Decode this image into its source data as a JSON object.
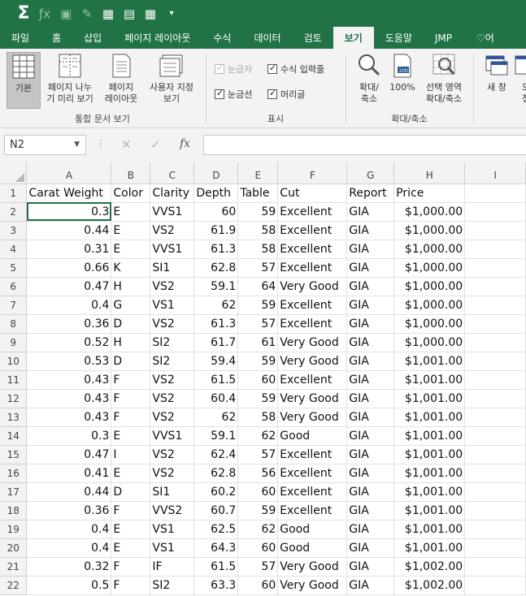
{
  "qat": {
    "sigma": "Σ"
  },
  "tabs": [
    "파일",
    "홈",
    "삽입",
    "페이지 레이아웃",
    "수식",
    "데이터",
    "검토",
    "보기",
    "도움말",
    "JMP",
    "어"
  ],
  "active_tab": "보기",
  "ribbon": {
    "views": {
      "normal": "기본",
      "pagebreak": "페이지 나누\n기 미리 보기",
      "layout": "페이지\n레이아웃",
      "custom": "사용자 지정\n보기",
      "label": "통합 문서 보기"
    },
    "show": {
      "ruler": "눈금자",
      "formula_bar": "수식 입력줄",
      "gridlines": "눈금선",
      "headings": "머리글",
      "label": "표시"
    },
    "zoom": {
      "zoom": "확대/\n축소",
      "hundred": "100%",
      "zoom_sel": "선택 영역\n확대/축소",
      "label": "확대/축소"
    },
    "window": {
      "new": "새 창",
      "more": "모\n정"
    }
  },
  "formula_bar": {
    "name_box": "N2",
    "fx": "fx",
    "value": ""
  },
  "columns": [
    "A",
    "B",
    "C",
    "D",
    "E",
    "F",
    "G",
    "H",
    "I"
  ],
  "header_row": [
    "Carat Weight",
    "Color",
    "Clarity",
    "Depth",
    "Table",
    "Cut",
    "Report",
    "Price",
    ""
  ],
  "rows": [
    [
      "0.3",
      "E",
      "VVS1",
      "60",
      "59",
      "Excellent",
      "GIA",
      "$1,000.00"
    ],
    [
      "0.44",
      "E",
      "VS2",
      "61.9",
      "58",
      "Excellent",
      "GIA",
      "$1,000.00"
    ],
    [
      "0.31",
      "E",
      "VVS1",
      "61.3",
      "58",
      "Excellent",
      "GIA",
      "$1,000.00"
    ],
    [
      "0.66",
      "K",
      "SI1",
      "62.8",
      "57",
      "Excellent",
      "GIA",
      "$1,000.00"
    ],
    [
      "0.47",
      "H",
      "VS2",
      "59.1",
      "64",
      "Very Good",
      "GIA",
      "$1,000.00"
    ],
    [
      "0.4",
      "G",
      "VS1",
      "62",
      "59",
      "Excellent",
      "GIA",
      "$1,000.00"
    ],
    [
      "0.36",
      "D",
      "VS2",
      "61.3",
      "57",
      "Excellent",
      "GIA",
      "$1,000.00"
    ],
    [
      "0.52",
      "H",
      "SI2",
      "61.7",
      "61",
      "Very Good",
      "GIA",
      "$1,000.00"
    ],
    [
      "0.53",
      "D",
      "SI2",
      "59.4",
      "59",
      "Very Good",
      "GIA",
      "$1,001.00"
    ],
    [
      "0.43",
      "F",
      "VS2",
      "61.5",
      "60",
      "Excellent",
      "GIA",
      "$1,001.00"
    ],
    [
      "0.43",
      "F",
      "VS2",
      "60.4",
      "59",
      "Very Good",
      "GIA",
      "$1,001.00"
    ],
    [
      "0.43",
      "F",
      "VS2",
      "62",
      "58",
      "Very Good",
      "GIA",
      "$1,001.00"
    ],
    [
      "0.3",
      "E",
      "VVS1",
      "59.1",
      "62",
      "Good",
      "GIA",
      "$1,001.00"
    ],
    [
      "0.47",
      "I",
      "VS2",
      "62.4",
      "57",
      "Excellent",
      "GIA",
      "$1,001.00"
    ],
    [
      "0.41",
      "E",
      "VS2",
      "62.8",
      "56",
      "Excellent",
      "GIA",
      "$1,001.00"
    ],
    [
      "0.44",
      "D",
      "SI1",
      "60.2",
      "60",
      "Excellent",
      "GIA",
      "$1,001.00"
    ],
    [
      "0.36",
      "F",
      "VVS2",
      "60.7",
      "59",
      "Excellent",
      "GIA",
      "$1,001.00"
    ],
    [
      "0.4",
      "E",
      "VS1",
      "62.5",
      "62",
      "Good",
      "GIA",
      "$1,001.00"
    ],
    [
      "0.4",
      "E",
      "VS1",
      "64.3",
      "60",
      "Good",
      "GIA",
      "$1,001.00"
    ],
    [
      "0.32",
      "F",
      "IF",
      "61.5",
      "57",
      "Very Good",
      "GIA",
      "$1,002.00"
    ],
    [
      "0.5",
      "F",
      "SI2",
      "63.3",
      "60",
      "Very Good",
      "GIA",
      "$1,002.00"
    ]
  ],
  "accent": "#217346"
}
